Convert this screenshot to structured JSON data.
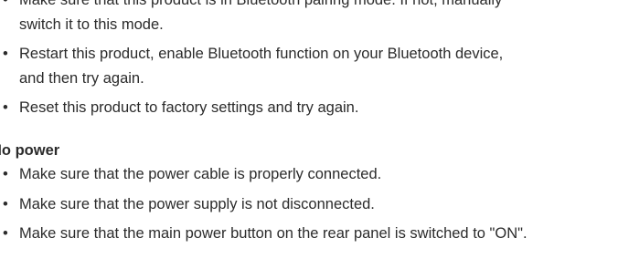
{
  "section1": {
    "items": [
      {
        "bullet": "•",
        "lines": [
          "Make sure that this product is in Bluetooth pairing mode. If not, manually",
          "switch it to this mode."
        ]
      },
      {
        "bullet": "•",
        "lines": [
          "Restart this product, enable Bluetooth function on your Bluetooth device,",
          "and then try again."
        ]
      },
      {
        "bullet": "•",
        "lines": [
          "Reset this product to factory settings and try again."
        ]
      }
    ]
  },
  "section2": {
    "heading": "No power",
    "items": [
      {
        "bullet": "•",
        "lines": [
          "Make sure that the power cable is properly connected."
        ]
      },
      {
        "bullet": "•",
        "lines": [
          "Make sure that the power supply is not disconnected."
        ]
      },
      {
        "bullet": "•",
        "lines": [
          "Make sure that the main power button on the rear panel is switched to \"ON\"."
        ]
      }
    ]
  }
}
